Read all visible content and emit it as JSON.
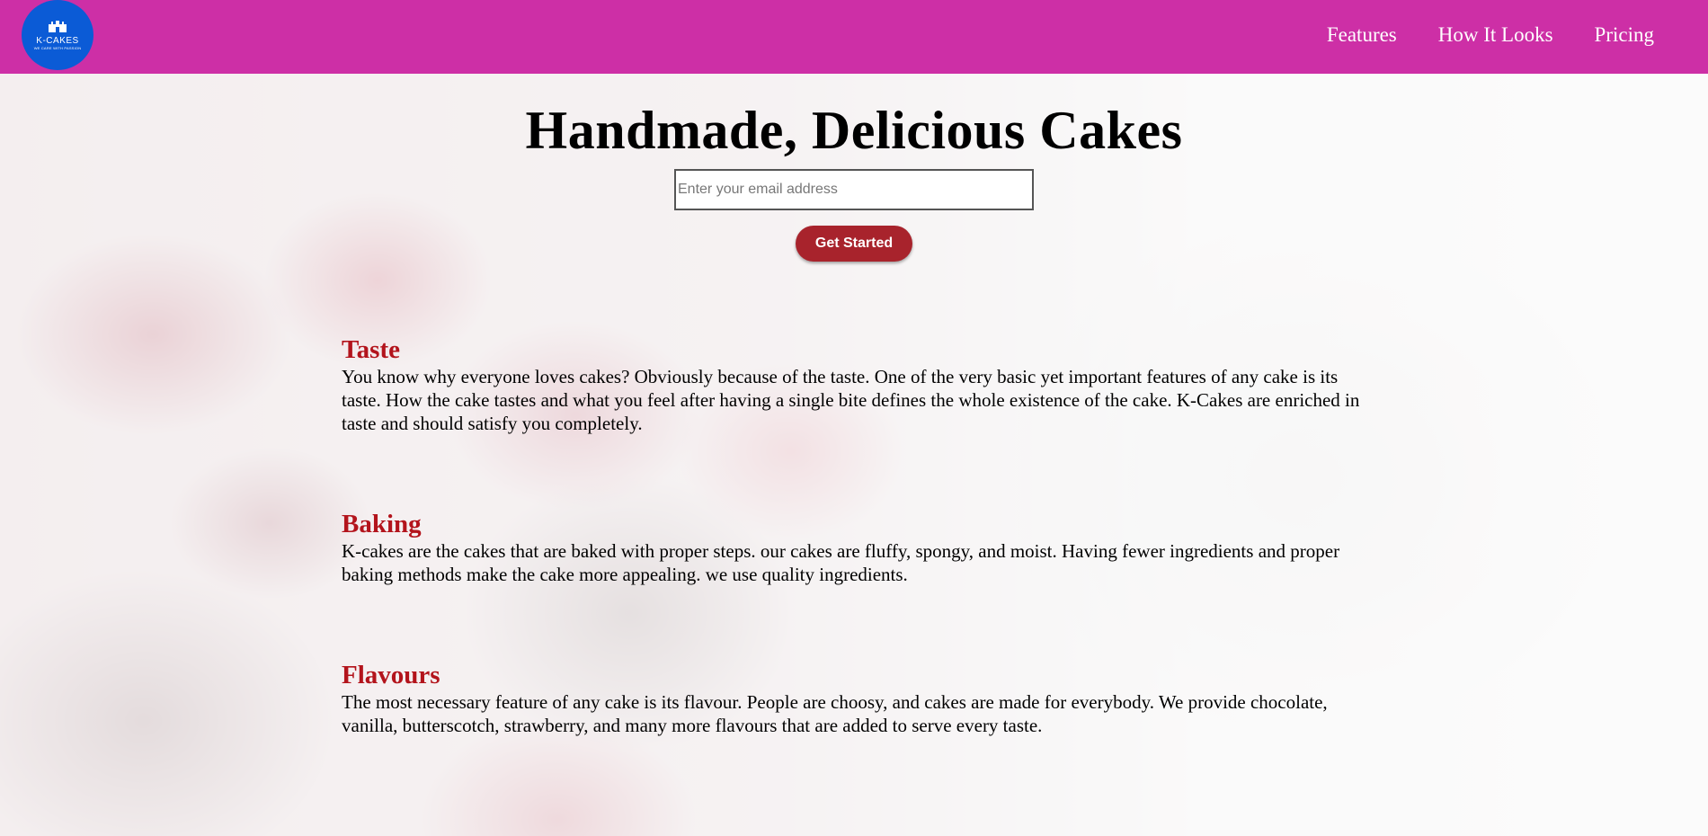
{
  "brand": {
    "name": "K-CAKES",
    "tagline": "WE CARE WITH PASSION",
    "logo_icon": "castle-icon",
    "colors": {
      "header": "#cd2fa6",
      "logo": "#0b5bd6",
      "accent": "#b3141c",
      "button": "#a8232c"
    }
  },
  "nav": {
    "items": [
      {
        "label": "Features"
      },
      {
        "label": "How It Looks"
      },
      {
        "label": "Pricing"
      }
    ]
  },
  "hero": {
    "title": "Handmade, Delicious Cakes",
    "email_placeholder": "Enter your email address",
    "email_value": "",
    "cta_label": "Get Started"
  },
  "features": [
    {
      "title": "Taste",
      "body": "You know why everyone loves cakes? Obviously because of the taste. One of the very basic yet important features of any cake is its taste. How the cake tastes and what you feel after having a single bite defines the whole existence of the cake. K-Cakes are enriched in taste and should satisfy you completely."
    },
    {
      "title": "Baking",
      "body": "K-cakes are the cakes that are baked with proper steps. our cakes are fluffy, spongy, and moist. Having fewer ingredients and proper baking methods make the cake more appealing. we use quality ingredients."
    },
    {
      "title": "Flavours",
      "body": "The most necessary feature of any cake is its flavour. People are choosy, and cakes are made for everybody. We provide chocolate, vanilla, butterscotch, strawberry, and many more flavours that are added to serve every taste."
    }
  ]
}
